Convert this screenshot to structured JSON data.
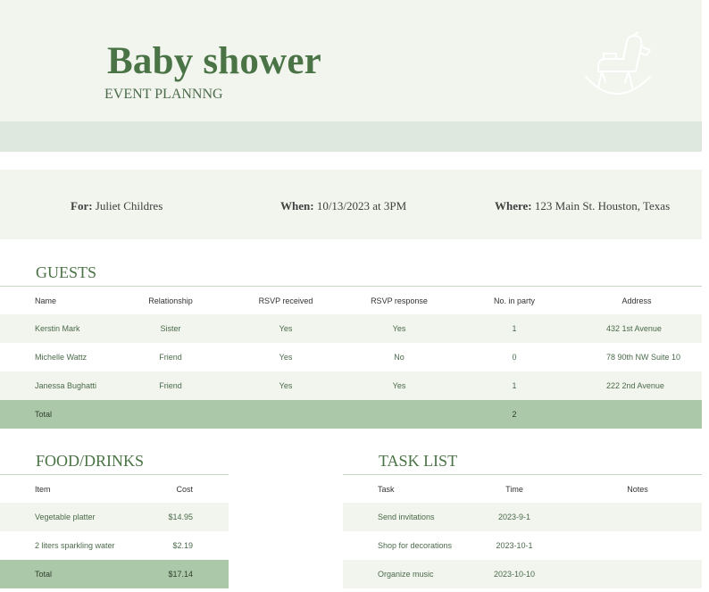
{
  "header": {
    "title": "Baby shower",
    "subtitle": "EVENT PLANNNG",
    "icon": "rocking-horse-icon"
  },
  "info": {
    "for_label": "For:",
    "for_value": "Juliet Childres",
    "when_label": "When:",
    "when_value": "10/13/2023 at 3PM",
    "where_label": "Where:",
    "where_value": "123 Main St. Houston, Texas"
  },
  "guests": {
    "title": "GUESTS",
    "headers": [
      "Name",
      "Relationship",
      "RSVP received",
      "RSVP response",
      "No. in party",
      "Address"
    ],
    "rows": [
      [
        "Kerstin Mark",
        "Sister",
        "Yes",
        "Yes",
        "1",
        "432 1st Avenue"
      ],
      [
        "Michelle Wattz",
        "Friend",
        "Yes",
        "No",
        "0",
        "78 90th NW Suite 10"
      ],
      [
        "Janessa Bughatti",
        "Friend",
        "Yes",
        "Yes",
        "1",
        "222 2nd Avenue"
      ]
    ],
    "total_label": "Total",
    "total_party": "2"
  },
  "food": {
    "title": "FOOD/DRINKS",
    "headers": [
      "Item",
      "Cost"
    ],
    "rows": [
      [
        "Vegetable platter",
        "$14.95"
      ],
      [
        "2 liters sparkling water",
        "$2.19"
      ]
    ],
    "total_label": "Total",
    "total_cost": "$17.14"
  },
  "tasks": {
    "title": "TASK LIST",
    "headers": [
      "Task",
      "Time",
      "Notes"
    ],
    "rows": [
      [
        "Send invitations",
        "2023-9-1",
        ""
      ],
      [
        "Shop for decorations",
        "2023-10-1",
        ""
      ],
      [
        "Organize music",
        "2023-10-10",
        ""
      ]
    ]
  },
  "colors": {
    "accent": "#4b7446",
    "band": "#dee8de",
    "light": "#f2f5ee",
    "total": "#abc9a8"
  }
}
